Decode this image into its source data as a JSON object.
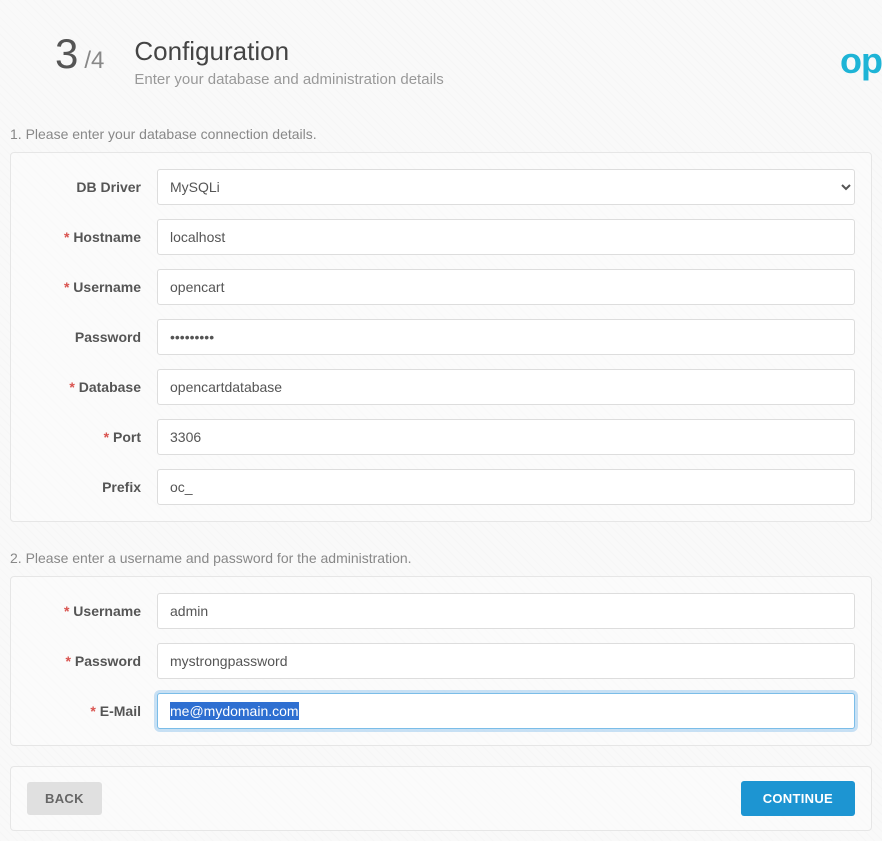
{
  "header": {
    "step_current": "3",
    "step_total": "/4",
    "title": "Configuration",
    "subtitle": "Enter your database and administration details",
    "logo": "op"
  },
  "section1": {
    "label": "1. Please enter your database connection details.",
    "fields": {
      "db_driver": {
        "label": "DB Driver",
        "value": "MySQLi"
      },
      "hostname": {
        "label": "Hostname",
        "value": "localhost"
      },
      "username": {
        "label": "Username",
        "value": "opencart"
      },
      "password": {
        "label": "Password",
        "value": "•••••••••"
      },
      "database": {
        "label": "Database",
        "value": "opencartdatabase"
      },
      "port": {
        "label": "Port",
        "value": "3306"
      },
      "prefix": {
        "label": "Prefix",
        "value": "oc_"
      }
    }
  },
  "section2": {
    "label": "2. Please enter a username and password for the administration.",
    "fields": {
      "username": {
        "label": "Username",
        "value": "admin"
      },
      "password": {
        "label": "Password",
        "value": "mystrongpassword"
      },
      "email": {
        "label": "E-Mail",
        "value": "me@mydomain.com"
      }
    }
  },
  "buttons": {
    "back": "BACK",
    "continue": "CONTINUE"
  }
}
